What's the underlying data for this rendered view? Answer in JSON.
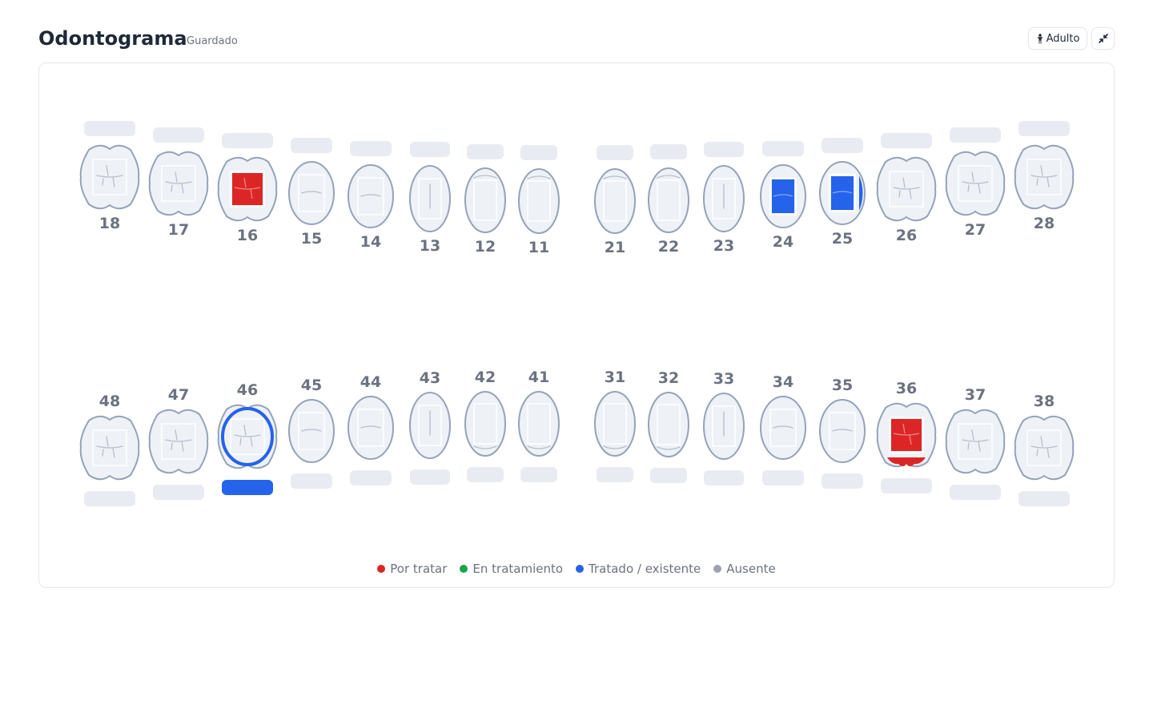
{
  "header": {
    "title": "Odontograma",
    "status": "Guardado",
    "mode_button_label": "Adulto",
    "mode_icon": "person-icon",
    "collapse_icon": "collapse-arrows-icon"
  },
  "colors": {
    "por_tratar": "#dc2626",
    "en_tratamiento": "#16a34a",
    "tratado": "#2563eb",
    "ausente": "#9ca3af",
    "tooth_fill": "#eef1f6",
    "tooth_stroke": "#94a3b8",
    "label": "#6b7280"
  },
  "upper_teeth": [
    {
      "number": "18",
      "type": "molar",
      "mark": null,
      "root": null,
      "selected": false
    },
    {
      "number": "17",
      "type": "molar",
      "mark": null,
      "root": null,
      "selected": false
    },
    {
      "number": "16",
      "type": "molar",
      "mark": "por_tratar",
      "root": null,
      "selected": false
    },
    {
      "number": "15",
      "type": "premolar",
      "mark": null,
      "root": null,
      "selected": false
    },
    {
      "number": "14",
      "type": "premolar",
      "mark": null,
      "root": null,
      "selected": false
    },
    {
      "number": "13",
      "type": "canine",
      "mark": null,
      "root": null,
      "selected": false
    },
    {
      "number": "12",
      "type": "incisor",
      "mark": null,
      "root": null,
      "selected": false
    },
    {
      "number": "11",
      "type": "incisor",
      "mark": null,
      "root": null,
      "selected": false
    },
    {
      "number": "21",
      "type": "incisor",
      "mark": null,
      "root": null,
      "selected": false
    },
    {
      "number": "22",
      "type": "incisor",
      "mark": null,
      "root": null,
      "selected": false
    },
    {
      "number": "23",
      "type": "canine",
      "mark": null,
      "root": null,
      "selected": false
    },
    {
      "number": "24",
      "type": "premolar",
      "mark": "tratado",
      "root": null,
      "selected": false
    },
    {
      "number": "25",
      "type": "premolar",
      "mark": "tratado",
      "side_mark": "tratado",
      "root": null,
      "selected": false
    },
    {
      "number": "26",
      "type": "molar",
      "mark": null,
      "root": null,
      "selected": false
    },
    {
      "number": "27",
      "type": "molar",
      "mark": null,
      "root": null,
      "selected": false
    },
    {
      "number": "28",
      "type": "molar",
      "mark": null,
      "root": null,
      "selected": false
    }
  ],
  "lower_teeth": [
    {
      "number": "48",
      "type": "molar",
      "mark": null,
      "root": null,
      "selected": false
    },
    {
      "number": "47",
      "type": "molar",
      "mark": null,
      "root": null,
      "selected": false
    },
    {
      "number": "46",
      "type": "molar",
      "mark": null,
      "root": "tratado",
      "selected": true
    },
    {
      "number": "45",
      "type": "premolar",
      "mark": null,
      "root": null,
      "selected": false
    },
    {
      "number": "44",
      "type": "premolar",
      "mark": null,
      "root": null,
      "selected": false
    },
    {
      "number": "43",
      "type": "canine",
      "mark": null,
      "root": null,
      "selected": false
    },
    {
      "number": "42",
      "type": "incisor",
      "mark": null,
      "root": null,
      "selected": false
    },
    {
      "number": "41",
      "type": "incisor",
      "mark": null,
      "root": null,
      "selected": false
    },
    {
      "number": "31",
      "type": "incisor",
      "mark": null,
      "root": null,
      "selected": false
    },
    {
      "number": "32",
      "type": "incisor",
      "mark": null,
      "root": null,
      "selected": false
    },
    {
      "number": "33",
      "type": "canine",
      "mark": null,
      "root": null,
      "selected": false
    },
    {
      "number": "34",
      "type": "premolar",
      "mark": null,
      "root": null,
      "selected": false
    },
    {
      "number": "35",
      "type": "premolar",
      "mark": null,
      "root": null,
      "selected": false
    },
    {
      "number": "36",
      "type": "molar",
      "mark": "por_tratar",
      "bottom_mark": "por_tratar",
      "root": null,
      "selected": false
    },
    {
      "number": "37",
      "type": "molar",
      "mark": null,
      "root": null,
      "selected": false
    },
    {
      "number": "38",
      "type": "molar",
      "mark": null,
      "root": null,
      "selected": false
    }
  ],
  "legend": [
    {
      "label": "Por tratar",
      "color": "#dc2626"
    },
    {
      "label": "En tratamiento",
      "color": "#16a34a"
    },
    {
      "label": "Tratado / existente",
      "color": "#2563eb"
    },
    {
      "label": "Ausente",
      "color": "#9ca3af"
    }
  ]
}
